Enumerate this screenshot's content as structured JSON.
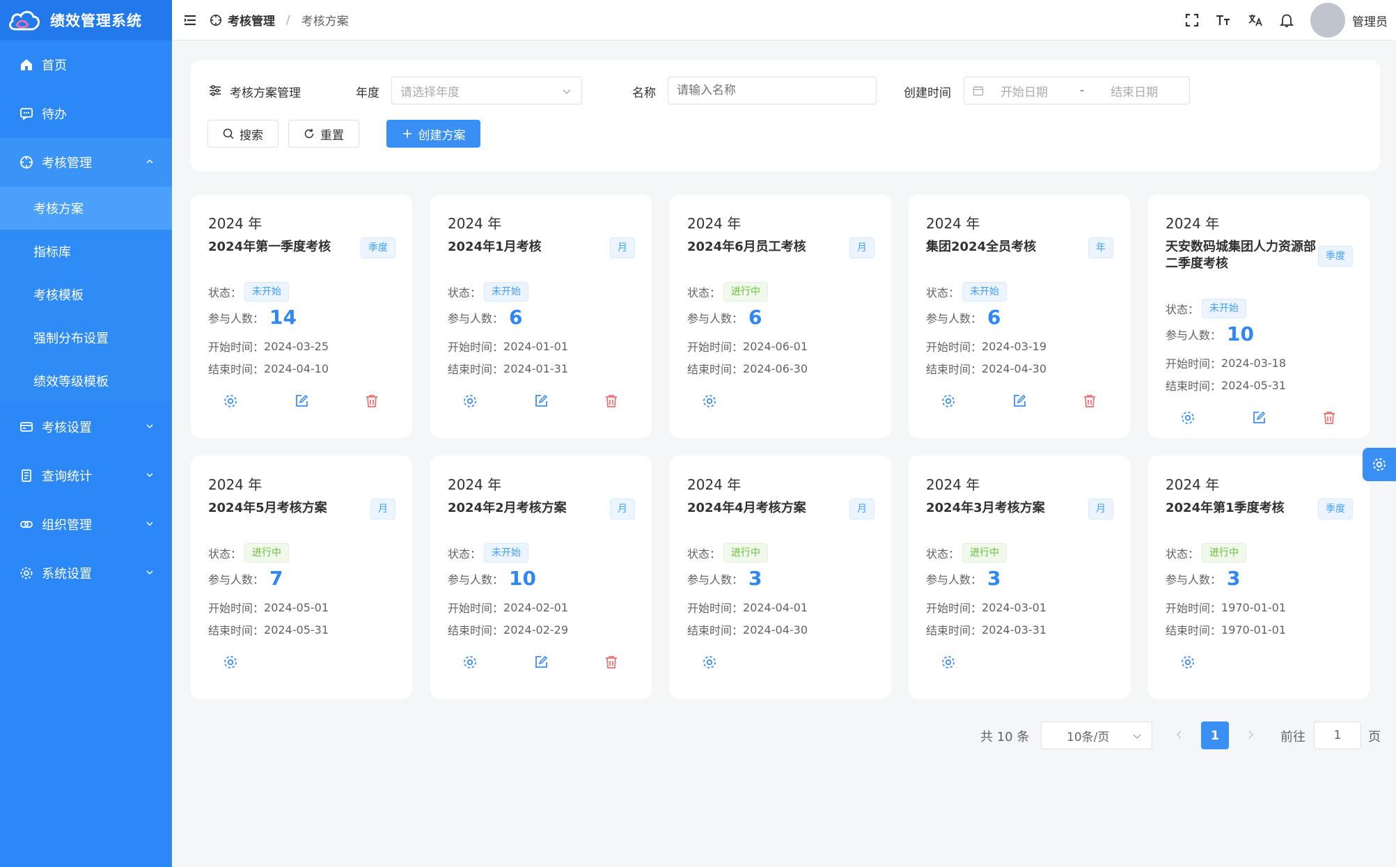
{
  "app": {
    "title": "绩效管理系统",
    "brand_color": "#2b88f6"
  },
  "sidebar": {
    "items": [
      {
        "label": "首页",
        "icon": "home-icon"
      },
      {
        "label": "待办",
        "icon": "message-icon"
      },
      {
        "label": "考核管理",
        "icon": "compass-icon",
        "open": true
      },
      {
        "label": "考核设置",
        "icon": "card-icon"
      },
      {
        "label": "查询统计",
        "icon": "document-icon"
      },
      {
        "label": "组织管理",
        "icon": "link-icon"
      },
      {
        "label": "系统设置",
        "icon": "gear-icon"
      }
    ],
    "submenu": [
      "考核方案",
      "指标库",
      "考核模板",
      "强制分布设置",
      "绩效等级模板"
    ],
    "active_sub": "考核方案"
  },
  "header": {
    "breadcrumb": [
      "考核管理",
      "考核方案"
    ],
    "user": "管理员"
  },
  "filter": {
    "title": "考核方案管理",
    "year_label": "年度",
    "year_placeholder": "请选择年度",
    "name_label": "名称",
    "name_placeholder": "请输入名称",
    "created_label": "创建时间",
    "start_placeholder": "开始日期",
    "range_sep": "-",
    "end_placeholder": "结束日期",
    "search_btn": "搜索",
    "reset_btn": "重置",
    "create_btn": "创建方案"
  },
  "labels": {
    "status": "状态：",
    "participants": "参与人数：",
    "start": "开始时间：",
    "end": "结束时间："
  },
  "cards": [
    {
      "year": "2024 年",
      "name": "2024年第一季度考核",
      "period": "季度",
      "status": "未开始",
      "count": "14",
      "start": "2024-03-25",
      "end": "2024-04-10"
    },
    {
      "year": "2024 年",
      "name": "2024年1月考核",
      "period": "月",
      "status": "未开始",
      "count": "6",
      "start": "2024-01-01",
      "end": "2024-01-31"
    },
    {
      "year": "2024 年",
      "name": "2024年6月员工考核",
      "period": "月",
      "status": "进行中",
      "count": "6",
      "start": "2024-06-01",
      "end": "2024-06-30"
    },
    {
      "year": "2024 年",
      "name": "集团2024全员考核",
      "period": "年",
      "status": "未开始",
      "count": "6",
      "start": "2024-03-19",
      "end": "2024-04-30"
    },
    {
      "year": "2024 年",
      "name": "天安数码城集团人力资源部二季度考核",
      "period": "季度",
      "status": "未开始",
      "count": "10",
      "start": "2024-03-18",
      "end": "2024-05-31"
    },
    {
      "year": "2024 年",
      "name": "2024年5月考核方案",
      "period": "月",
      "status": "进行中",
      "count": "7",
      "start": "2024-05-01",
      "end": "2024-05-31"
    },
    {
      "year": "2024 年",
      "name": "2024年2月考核方案",
      "period": "月",
      "status": "未开始",
      "count": "10",
      "start": "2024-02-01",
      "end": "2024-02-29"
    },
    {
      "year": "2024 年",
      "name": "2024年4月考核方案",
      "period": "月",
      "status": "进行中",
      "count": "3",
      "start": "2024-04-01",
      "end": "2024-04-30"
    },
    {
      "year": "2024 年",
      "name": "2024年3月考核方案",
      "period": "月",
      "status": "进行中",
      "count": "3",
      "start": "2024-03-01",
      "end": "2024-03-31"
    },
    {
      "year": "2024 年",
      "name": "2024年第1季度考核",
      "period": "季度",
      "status": "进行中",
      "count": "3",
      "start": "1970-01-01",
      "end": "1970-01-01"
    }
  ],
  "pagination": {
    "total": "共 10 条",
    "page_size": "10条/页",
    "current": "1",
    "goto_label": "前往",
    "goto_value": "1",
    "page_unit": "页"
  }
}
